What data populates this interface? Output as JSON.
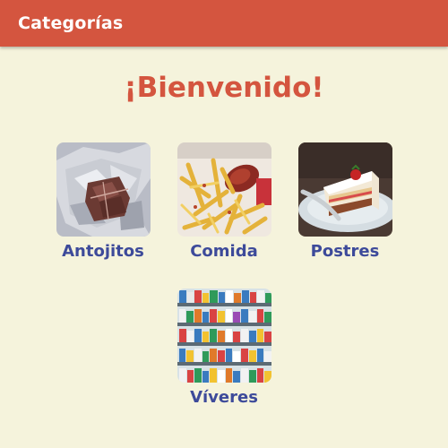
{
  "app_bar": {
    "title": "Categorías",
    "color": "#d4553f"
  },
  "welcome": {
    "text": "¡Bienvenido!"
  },
  "categories": [
    {
      "label": "Antojitos",
      "image": "wrapped-chocolate-in-foil"
    },
    {
      "label": "Comida",
      "image": "fries-and-sausage"
    },
    {
      "label": "Postres",
      "image": "cake-slice-on-plate"
    },
    {
      "label": "Víveres",
      "image": "grocery-store-shelves"
    }
  ],
  "colors": {
    "background": "#f5f3dc",
    "accent": "#d4553f",
    "label": "#3d4a9a"
  }
}
